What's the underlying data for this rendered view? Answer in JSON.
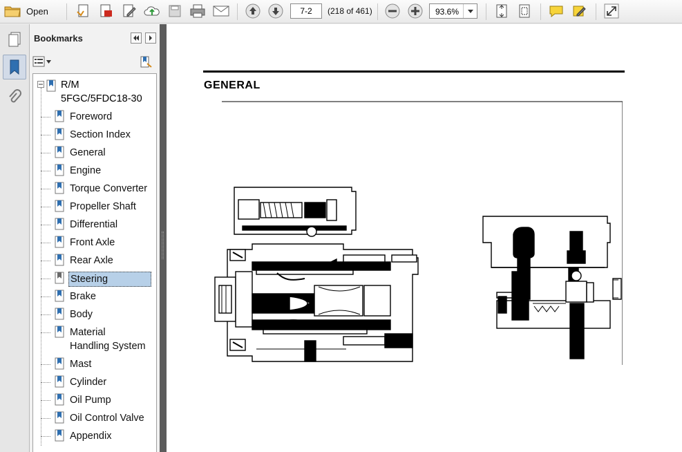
{
  "toolbar": {
    "open_label": "Open",
    "page_value": "7-2",
    "page_count": "(218 of 461)",
    "zoom_value": "93.6%"
  },
  "bookmarks": {
    "title": "Bookmarks",
    "root": {
      "label_line1": "R/M",
      "label_line2": "5FGC/5FDC18-30"
    },
    "items": [
      {
        "label": "Foreword"
      },
      {
        "label": "Section Index"
      },
      {
        "label": "General"
      },
      {
        "label": "Engine"
      },
      {
        "label": "Torque Converter"
      },
      {
        "label": "Propeller Shaft"
      },
      {
        "label": "Differential"
      },
      {
        "label": "Front Axle"
      },
      {
        "label": "Rear Axle"
      },
      {
        "label": "Steering"
      },
      {
        "label": "Brake"
      },
      {
        "label": "Body"
      },
      {
        "label": "Material"
      },
      {
        "label": "Handling System"
      },
      {
        "label": "Mast"
      },
      {
        "label": "Cylinder"
      },
      {
        "label": "Oil Pump"
      },
      {
        "label": "Oil Control Valve"
      },
      {
        "label": "Appendix"
      }
    ],
    "selected": "Steering"
  },
  "document": {
    "heading": "GENERAL"
  },
  "colors": {
    "selection": "#b7d0e8",
    "splitter": "#5c5c5c",
    "bookmark_icon": "#2f6fb0"
  }
}
